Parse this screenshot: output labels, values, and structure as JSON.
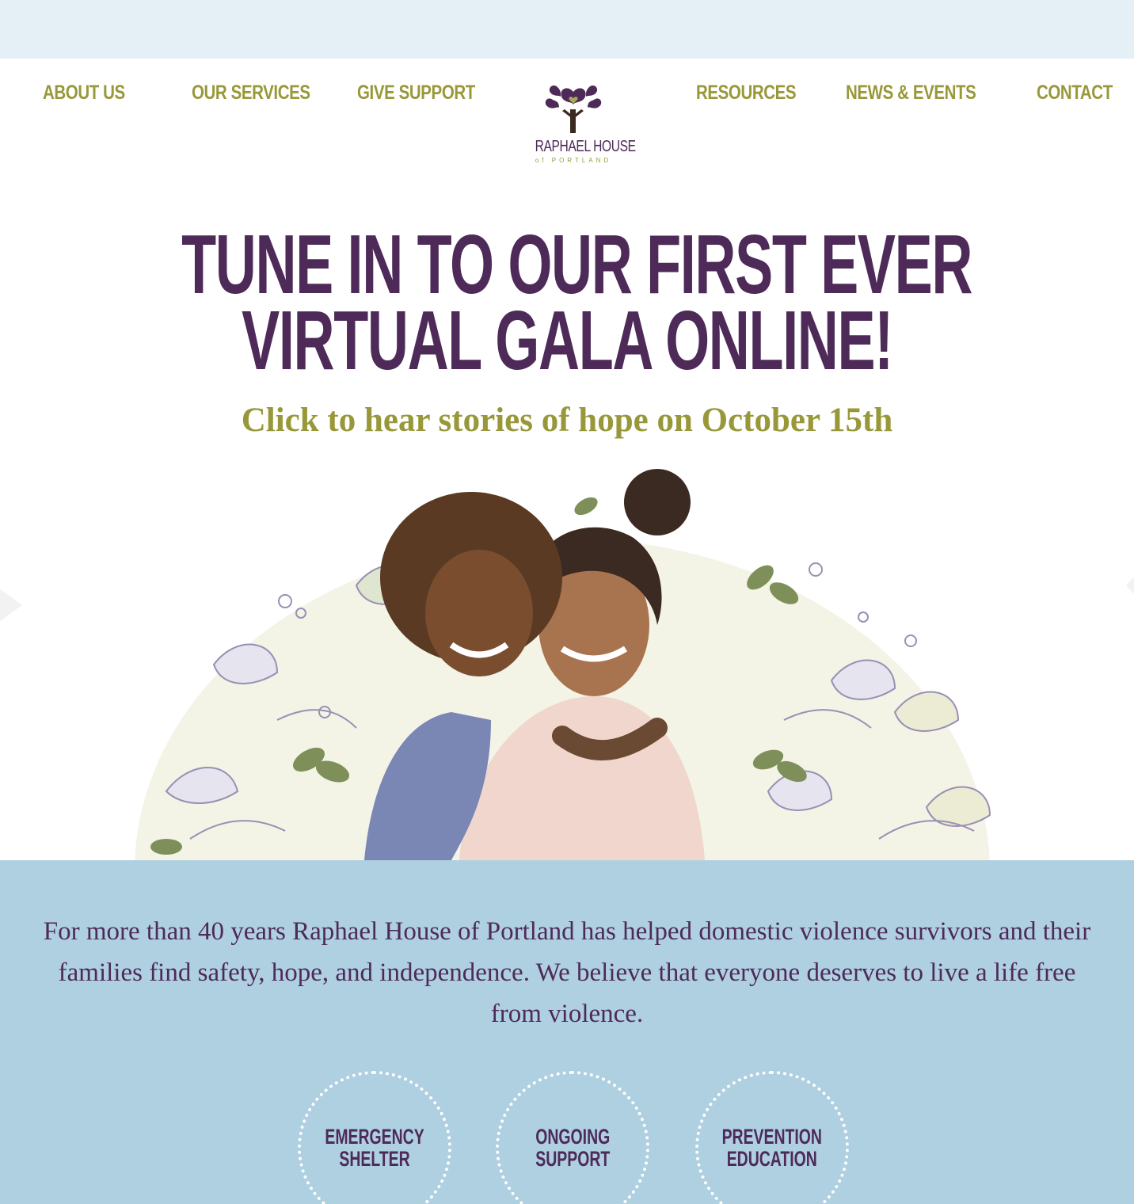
{
  "nav": {
    "about": "ABOUT US",
    "services": "OUR SERVICES",
    "support": "GIVE SUPPORT",
    "resources": "RESOURCES",
    "news": "NEWS & EVENTS",
    "contact": "CONTACT"
  },
  "logo": {
    "name": "RAPHAEL HOUSE",
    "sub": "of PORTLAND",
    "icon": "tree-heart-icon"
  },
  "hero": {
    "title_line1": "TUNE IN TO OUR FIRST EVER",
    "title_line2": "VIRTUAL GALA ONLINE!",
    "subtitle": "Click to hear stories of hope on October 15th"
  },
  "mission": {
    "text": "For more than 40 years Raphael House of Portland has helped domestic violence survivors and their families find safety, hope, and independence. We believe that everyone deserves to live a life free from violence."
  },
  "programs": [
    {
      "label": "EMERGENCY\nSHELTER"
    },
    {
      "label": "ONGOING\nSUPPORT"
    },
    {
      "label": "PREVENTION\nEDUCATION"
    }
  ],
  "colors": {
    "purple": "#4e2a59",
    "olive": "#98983a",
    "sky": "#aed0e1",
    "topbar": "#e4f0f6"
  }
}
